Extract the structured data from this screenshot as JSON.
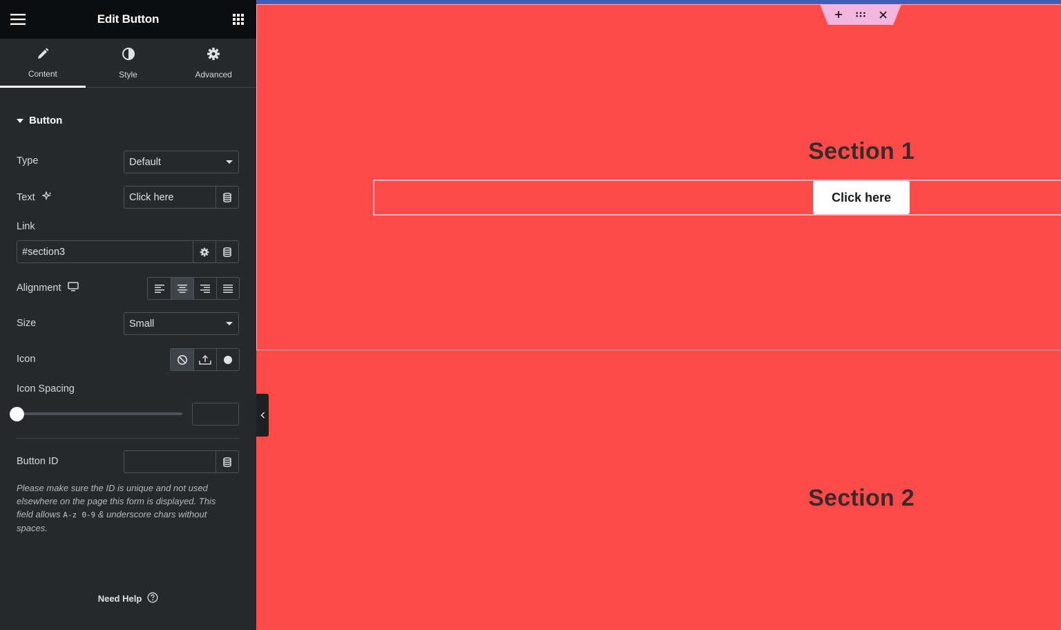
{
  "panel": {
    "title": "Edit Button",
    "tabs": [
      {
        "label": "Content",
        "icon": "pencil-icon",
        "active": true
      },
      {
        "label": "Style",
        "icon": "contrast-icon",
        "active": false
      },
      {
        "label": "Advanced",
        "icon": "gear-icon",
        "active": false
      }
    ],
    "section_title": "Button",
    "controls": {
      "type": {
        "label": "Type",
        "value": "Default"
      },
      "text": {
        "label": "Text",
        "value": "Click here"
      },
      "link": {
        "label": "Link",
        "value": "#section3"
      },
      "alignment": {
        "label": "Alignment",
        "selected": "center"
      },
      "size": {
        "label": "Size",
        "value": "Small"
      },
      "icon": {
        "label": "Icon",
        "selected": "none"
      },
      "icon_spacing": {
        "label": "Icon Spacing",
        "value": ""
      },
      "button_id": {
        "label": "Button ID",
        "value": ""
      }
    },
    "help_note": {
      "part1": "Please make sure the ID is unique and not used elsewhere on the page this form is displayed. This field allows ",
      "code1": "A-z",
      "code2": "0-9",
      "part2": " & underscore chars without spaces."
    },
    "need_help": "Need Help"
  },
  "canvas": {
    "section1_heading": "Section 1",
    "button_text": "Click here",
    "section2_heading": "Section 2"
  },
  "colors": {
    "canvas_bg": "#ff4a4a",
    "panel_bg": "#26292c",
    "header_bg": "#0c0d0e",
    "toolbar_pink": "#f3b6df",
    "topbar_blue": "#3d5fb8"
  }
}
